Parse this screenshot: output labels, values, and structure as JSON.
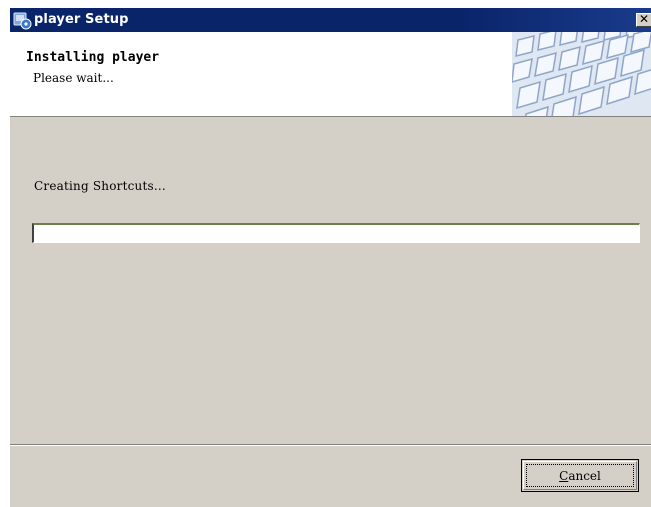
{
  "window": {
    "title": "player Setup",
    "close_glyph": "✕",
    "title_icon": "installer-icon",
    "titlebar_color": "#0a246a",
    "face_color": "#d4d0c8"
  },
  "header": {
    "title": "Installing player",
    "subtitle": "Please wait...",
    "art_icon": "keyboard-keys-art"
  },
  "body": {
    "status": "Creating Shortcuts...",
    "progress_fraction": 0.0
  },
  "footer": {
    "cancel_mnemonic": "C",
    "cancel_rest": "ancel"
  }
}
